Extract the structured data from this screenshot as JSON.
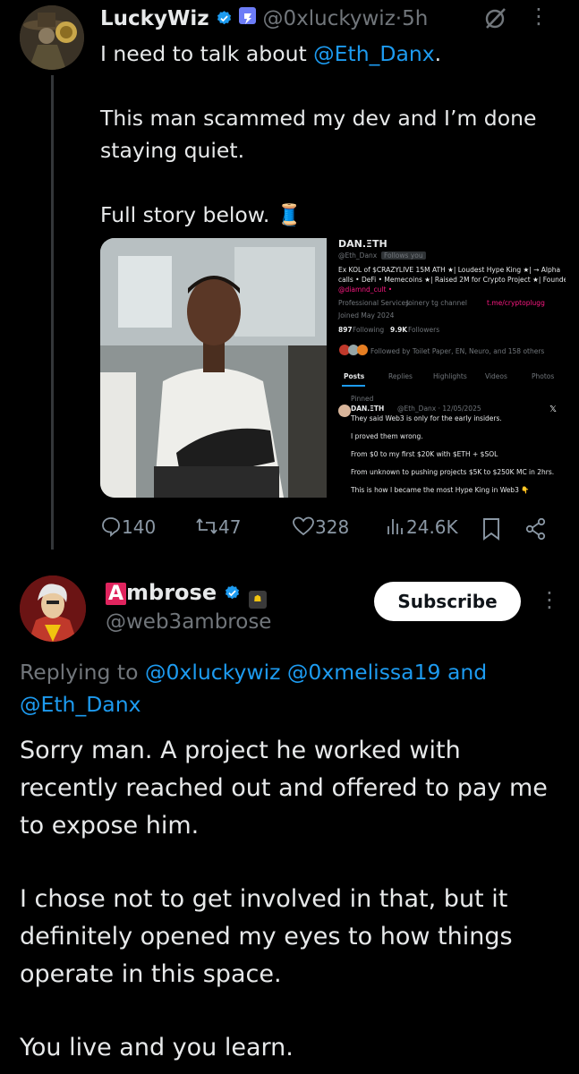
{
  "tweet1": {
    "name": "LuckyWiz",
    "handle": "@0xluckywiz",
    "dot": "·",
    "time": "5h",
    "more": "⋮",
    "body_line1_pre": "I need to talk about ",
    "body_line1_mention": "@Eth_Danx",
    "body_line1_post": ".",
    "body_p2": "This man scammed my dev and I’m done staying quiet.",
    "body_p3": "Full story below. 🧵",
    "actions": {
      "replies": "140",
      "reposts": "47",
      "likes": "328",
      "views": "24.6K"
    }
  },
  "embedded_profile": {
    "name": "DAN.ΞTH",
    "handle": "@Eth_Danx",
    "follows_you": "Follows you",
    "bio_line1": "Ex KOL of $CRAZYLIVE 15M ATH ★| Loudest Hype King ★| → Alpha",
    "bio_line2": "calls • DeFi • Memecoins ★| Raised 2M for Crypto Project ★| Founder",
    "bio_line3": "@diamnd_cult •",
    "meta_services": "Professional Services",
    "meta_location": "Joinery tg channel",
    "meta_link": "t.me/cryptoplugg",
    "joined": "Joined May 2024",
    "following_count": "897",
    "following_label": "Following",
    "followers_count": "9.9K",
    "followers_label": "Followers",
    "followed_by": "Followed by Toilet Paper, EN, Neuro, and 158 others",
    "tabs": [
      "Posts",
      "Replies",
      "Highlights",
      "Videos",
      "Photos"
    ],
    "pinned": "Pinned",
    "post_name": "DAN.ΞTH",
    "post_meta": "@Eth_Danx · 12/05/2025",
    "post_line1": "They said Web3 is only for the early insiders.",
    "post_line2": "I proved them wrong.",
    "post_line3": "From $0 to my first $20K with $ETH + $SOL",
    "post_line4": "From unknown to pushing projects $5K to $250K MC in 2hrs.",
    "post_line5": "This is how I became the most Hype King in Web3 👇"
  },
  "tweet2": {
    "name": "Ambrose",
    "handle": "@web3ambrose",
    "subscribe": "Subscribe",
    "more": "⋮",
    "replying_prefix": "Replying to ",
    "replying_1": "@0xluckywiz",
    "replying_2": "@0xmelissa19",
    "replying_and": " and",
    "replying_3": "@Eth_Danx",
    "body_p1": "Sorry man. A project he worked with recently reached out and offered to pay me to expose him.",
    "body_p2": "I chose not to get involved in that, but it definitely opened my eyes to how things operate in this space.",
    "body_p3": "You live and you learn."
  },
  "colors": {
    "accent": "#1d9bf0",
    "muted": "#71767b",
    "background": "#000000"
  }
}
